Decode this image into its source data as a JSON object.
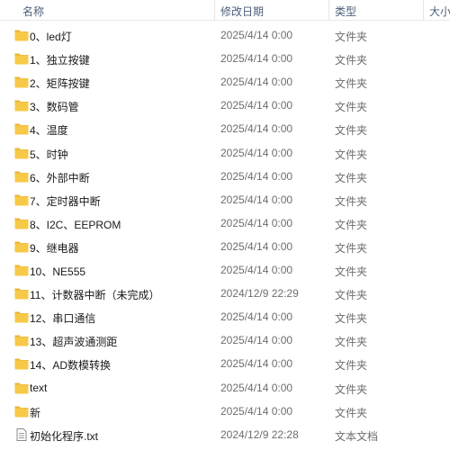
{
  "header": {
    "name": "名称",
    "date": "修改日期",
    "type": "类型",
    "size": "大小"
  },
  "files": [
    {
      "name": "0、led灯",
      "date": "2025/4/14 0:00",
      "type": "文件夹",
      "icon": "folder-icon"
    },
    {
      "name": "1、独立按键",
      "date": "2025/4/14 0:00",
      "type": "文件夹",
      "icon": "folder-icon"
    },
    {
      "name": "2、矩阵按键",
      "date": "2025/4/14 0:00",
      "type": "文件夹",
      "icon": "folder-icon"
    },
    {
      "name": "3、数码管",
      "date": "2025/4/14 0:00",
      "type": "文件夹",
      "icon": "folder-icon"
    },
    {
      "name": "4、温度",
      "date": "2025/4/14 0:00",
      "type": "文件夹",
      "icon": "folder-icon"
    },
    {
      "name": "5、时钟",
      "date": "2025/4/14 0:00",
      "type": "文件夹",
      "icon": "folder-icon"
    },
    {
      "name": "6、外部中断",
      "date": "2025/4/14 0:00",
      "type": "文件夹",
      "icon": "folder-icon"
    },
    {
      "name": "7、定时器中断",
      "date": "2025/4/14 0:00",
      "type": "文件夹",
      "icon": "folder-icon"
    },
    {
      "name": "8、I2C、EEPROM",
      "date": "2025/4/14 0:00",
      "type": "文件夹",
      "icon": "folder-icon"
    },
    {
      "name": "9、继电器",
      "date": "2025/4/14 0:00",
      "type": "文件夹",
      "icon": "folder-icon"
    },
    {
      "name": "10、NE555",
      "date": "2025/4/14 0:00",
      "type": "文件夹",
      "icon": "folder-icon"
    },
    {
      "name": "11、计数器中断（未完成）",
      "date": "2024/12/9 22:29",
      "type": "文件夹",
      "icon": "folder-icon"
    },
    {
      "name": "12、串口通信",
      "date": "2025/4/14 0:00",
      "type": "文件夹",
      "icon": "folder-icon"
    },
    {
      "name": "13、超声波通测距",
      "date": "2025/4/14 0:00",
      "type": "文件夹",
      "icon": "folder-icon"
    },
    {
      "name": "14、AD数模转换",
      "date": "2025/4/14 0:00",
      "type": "文件夹",
      "icon": "folder-icon"
    },
    {
      "name": "text",
      "date": "2025/4/14 0:00",
      "type": "文件夹",
      "icon": "folder-icon"
    },
    {
      "name": "新",
      "date": "2025/4/14 0:00",
      "type": "文件夹",
      "icon": "folder-icon"
    },
    {
      "name": "初始化程序.txt",
      "date": "2024/12/9 22:28",
      "type": "文本文档",
      "icon": "text-file-icon"
    }
  ]
}
